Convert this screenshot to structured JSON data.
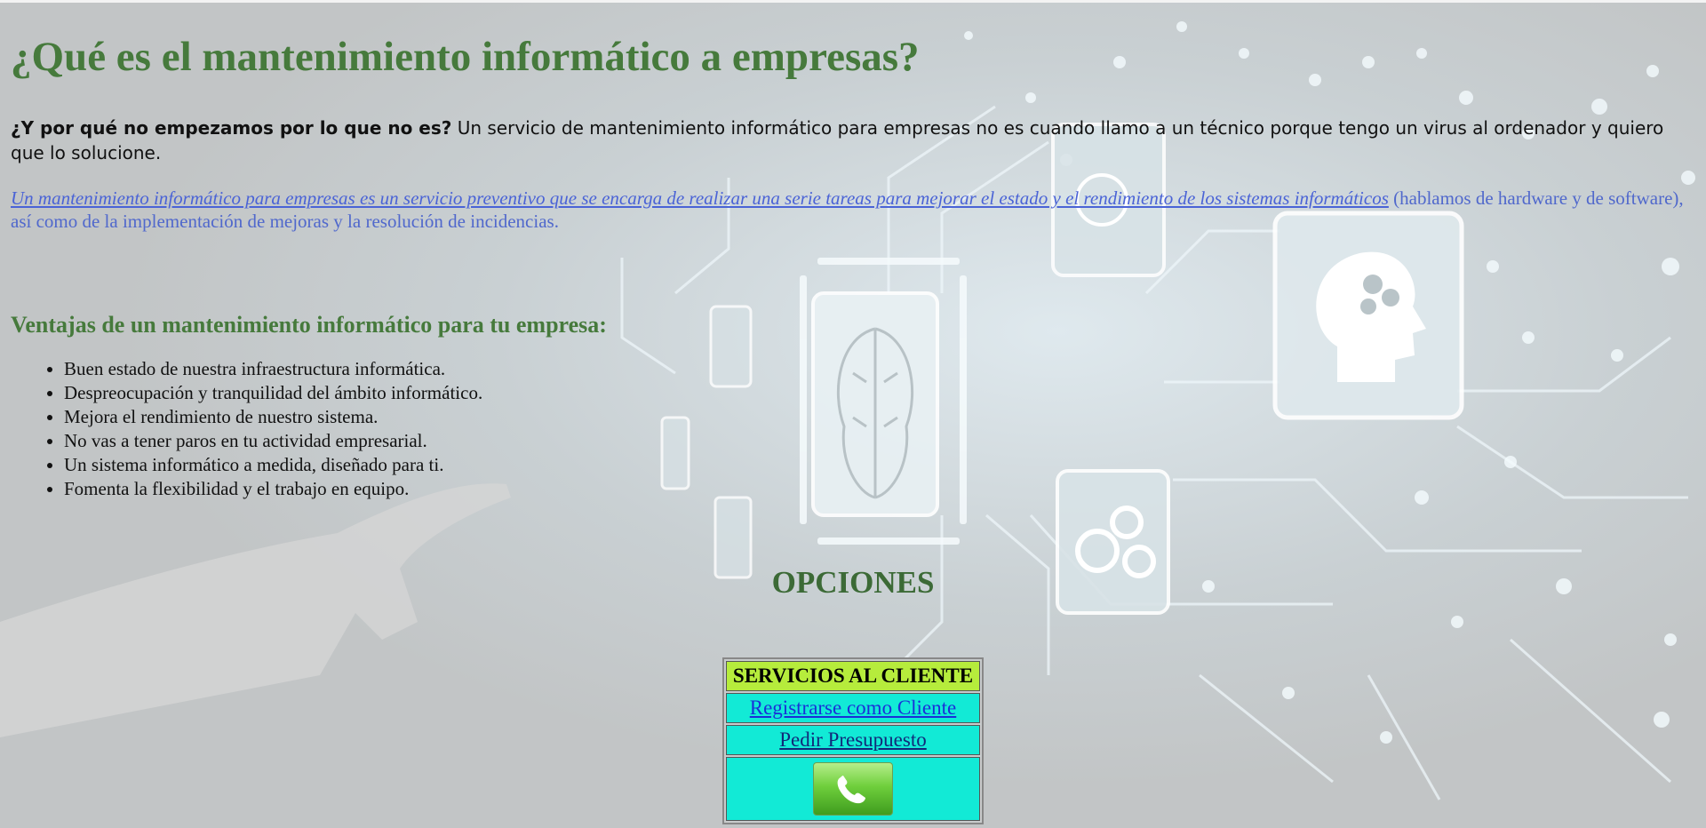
{
  "heading": "¿Qué es el mantenimiento informático a empresas?",
  "intro": {
    "bold": "¿Y por qué no empezamos por lo que no es?",
    "rest": " Un servicio de mantenimiento informático para empresas no es cuando llamo a un técnico porque tengo un virus al ordenador y quiero que lo solucione."
  },
  "definition": {
    "link": "Un mantenimiento informático para empresas es un servicio preventivo que se encarga de realizar una serie tareas para mejorar el estado y el rendimiento de los sistemas informáticos",
    "rest": " (hablamos de hardware y de software), así como de la implementación de mejoras y la resolución de incidencias."
  },
  "advantages": {
    "title": "Ventajas de un mantenimiento informático para tu empresa:",
    "items": [
      "Buen estado de nuestra infraestructura informática.",
      "Despreocupación y tranquilidad del ámbito informático.",
      "Mejora el rendimiento de nuestro sistema.",
      "No vas a tener paros en tu actividad empresarial.",
      "Un sistema informático a medida, diseñado para ti.",
      "Fomenta la flexibilidad y el trabajo en equipo."
    ]
  },
  "options": {
    "title": "OPCIONES",
    "table_header": "SERVICIOS AL CLIENTE",
    "register_link": "Registrarse como Cliente",
    "quote_link": "Pedir Presupuesto",
    "phone_icon": "phone-icon"
  },
  "colors": {
    "heading_green": "#467a3c",
    "cell_cyan": "#12ead6",
    "header_lime": "#b6ec3c",
    "link_blue": "#4a63d6"
  }
}
